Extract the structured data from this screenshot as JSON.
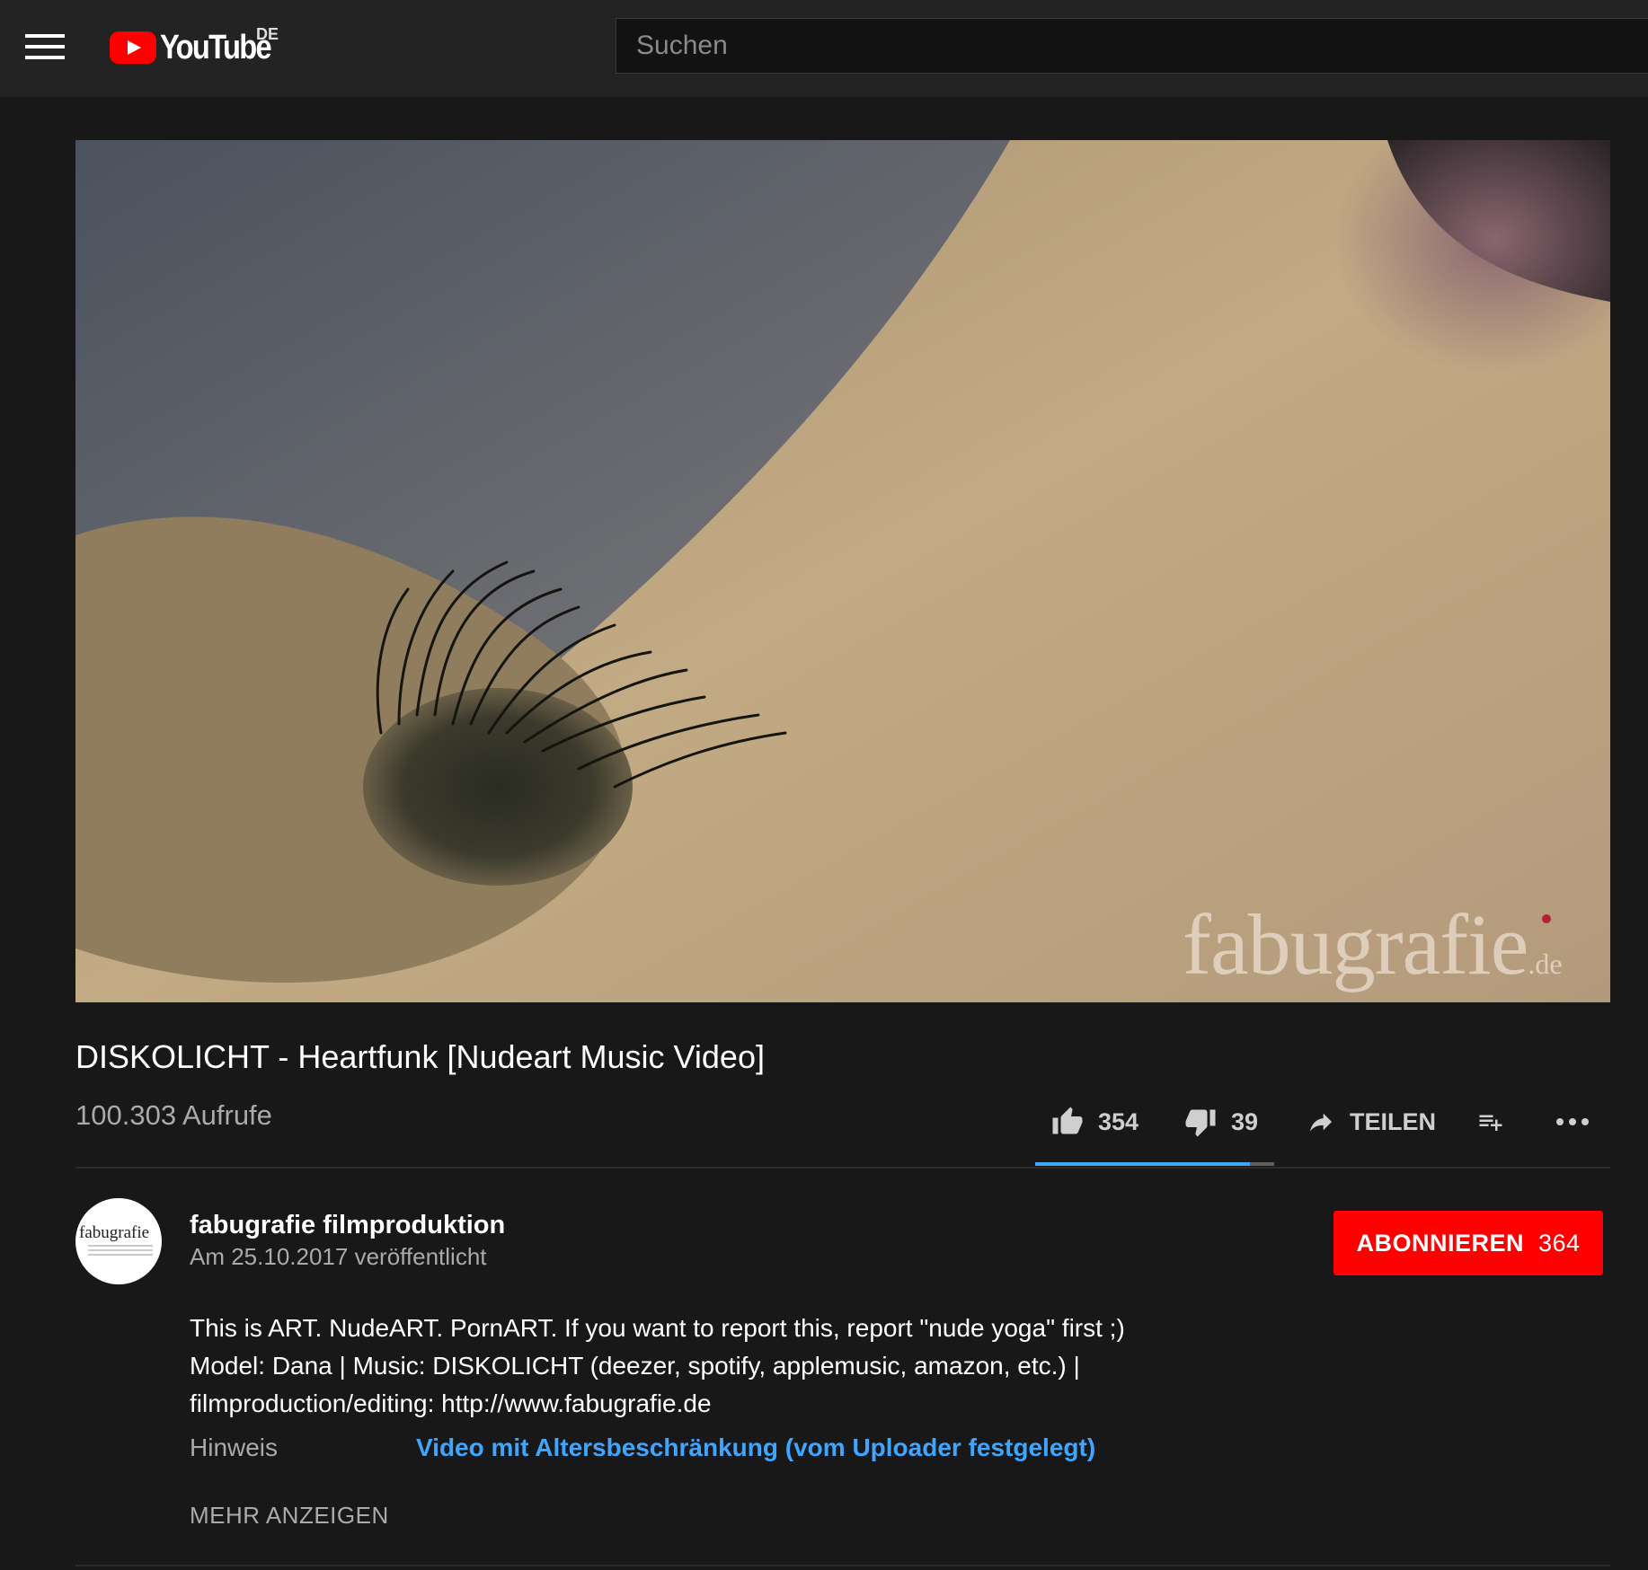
{
  "header": {
    "logo_text": "YouTube",
    "country_code": "DE",
    "search_placeholder": "Suchen"
  },
  "player": {
    "watermark_main": "fabugrafie",
    "watermark_tld": ".de"
  },
  "video": {
    "title": "DISKOLICHT - Heartfunk [Nudeart Music Video]",
    "views": "100.303 Aufrufe",
    "likes": "354",
    "dislikes": "39",
    "share_label": "TEILEN",
    "like_ratio": 0.9
  },
  "channel": {
    "name": "fabugrafie filmproduktion",
    "published": "Am 25.10.2017 veröffentlicht",
    "avatar_text": "fabugrafie",
    "subscribe_label": "ABONNIEREN",
    "subscriber_count": "364"
  },
  "description": {
    "line1": "This is ART. NudeART. PornART. If you want to report this, report \"nude yoga\" first ;)",
    "line2": "Model: Dana | Music: DISKOLICHT (deezer, spotify, applemusic, amazon, etc.) |",
    "line3": "filmproduction/editing: http://www.fabugrafie.de",
    "meta_label": "Hinweis",
    "meta_value": "Video mit Altersbeschränkung (vom Uploader festgelegt)",
    "show_more_label": "MEHR ANZEIGEN"
  },
  "colors": {
    "background": "#181818",
    "topbar": "#232323",
    "brand_red": "#ff0000",
    "link_blue": "#3ea6ff"
  }
}
